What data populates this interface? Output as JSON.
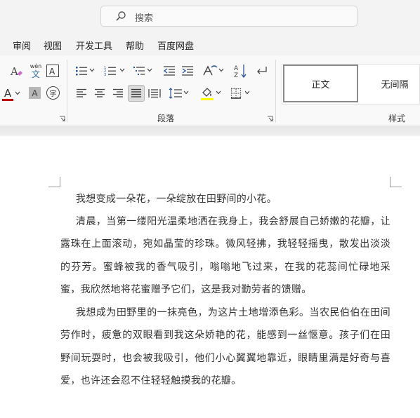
{
  "search": {
    "placeholder": "搜索"
  },
  "menu": [
    "审阅",
    "视图",
    "开发工具",
    "帮助",
    "百度网盘"
  ],
  "ribbon": {
    "wen_glyph_top": "wén",
    "wen_glyph_bottom": "文",
    "font_color_glyph": "A",
    "shade_glyph": "A",
    "enclose_glyph": "字",
    "sort_glyph_a": "A",
    "sort_glyph_z": "Z",
    "paragraph_group": "段落",
    "styles_group": "样式",
    "style_normal": "正文",
    "style_nospacing": "无间隔"
  },
  "colors": {
    "font_color_bar": "#c00000",
    "highlight_bar": "#ffff00",
    "accent": "#2b579a"
  },
  "document": {
    "paragraphs": [
      "我想变成一朵花，一朵绽放在田野间的小花。",
      "清晨，当第一缕阳光温柔地洒在我身上，我会舒展自己娇嫩的花瓣，让露珠在上面滚动，宛如晶莹的珍珠。微风轻拂，我轻轻摇曳，散发出淡淡的芬芳。蜜蜂被我的香气吸引，嗡嗡地飞过来，在我的花蕊间忙碌地采蜜，我欣然地将花蜜赠予它们，这是我对勤劳者的馈赠。",
      "我想成为田野里的一抹亮色，为这片土地增添色彩。当农民伯伯在田间劳作时，疲惫的双眼看到我这朵娇艳的花，能感到一丝惬意。孩子们在田野间玩耍时，也会被我吸引，他们小心翼翼地靠近，眼睛里满是好奇与喜爱，也许还会忍不住轻轻触摸我的花瓣。"
    ]
  }
}
